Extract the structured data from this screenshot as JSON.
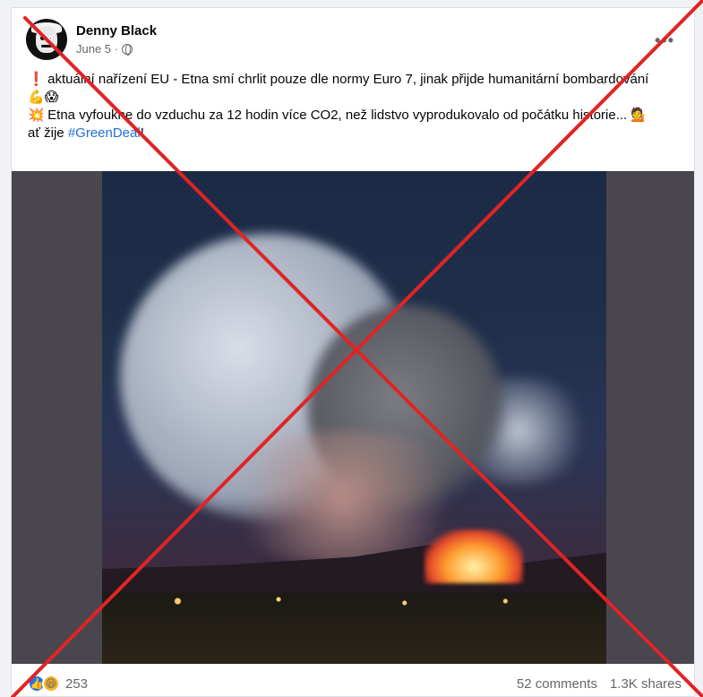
{
  "post": {
    "author": "Denny Black",
    "date": "June 5",
    "separator": "·",
    "more": "•••",
    "lines": {
      "l1_icon": "❗",
      "l1": "aktuální nařízení EU - Etna smí chrlit pouze dle normy Euro 7, jinak přijde humanitární bombardování",
      "l2": "💪😱",
      "l3_icon": "💥",
      "l3": "Etna vyfoukne do vzduchu za 12 hodin více CO2, než lidstvo vyprodukovalo od počátku historie... 💁",
      "l4_prefix": "ať žije ",
      "l4_hashtag": "#GreenDeal",
      "l4_suffix": "!"
    }
  },
  "footer": {
    "reaction_count": "253",
    "comments": "52 comments",
    "shares": "1.3K shares"
  },
  "icons": {
    "globe": "globe-icon",
    "like": "like-icon",
    "haha": "haha-icon"
  },
  "colors": {
    "hashtag": "#216fdb",
    "cross": "#e02424",
    "like": "#1877f2"
  }
}
